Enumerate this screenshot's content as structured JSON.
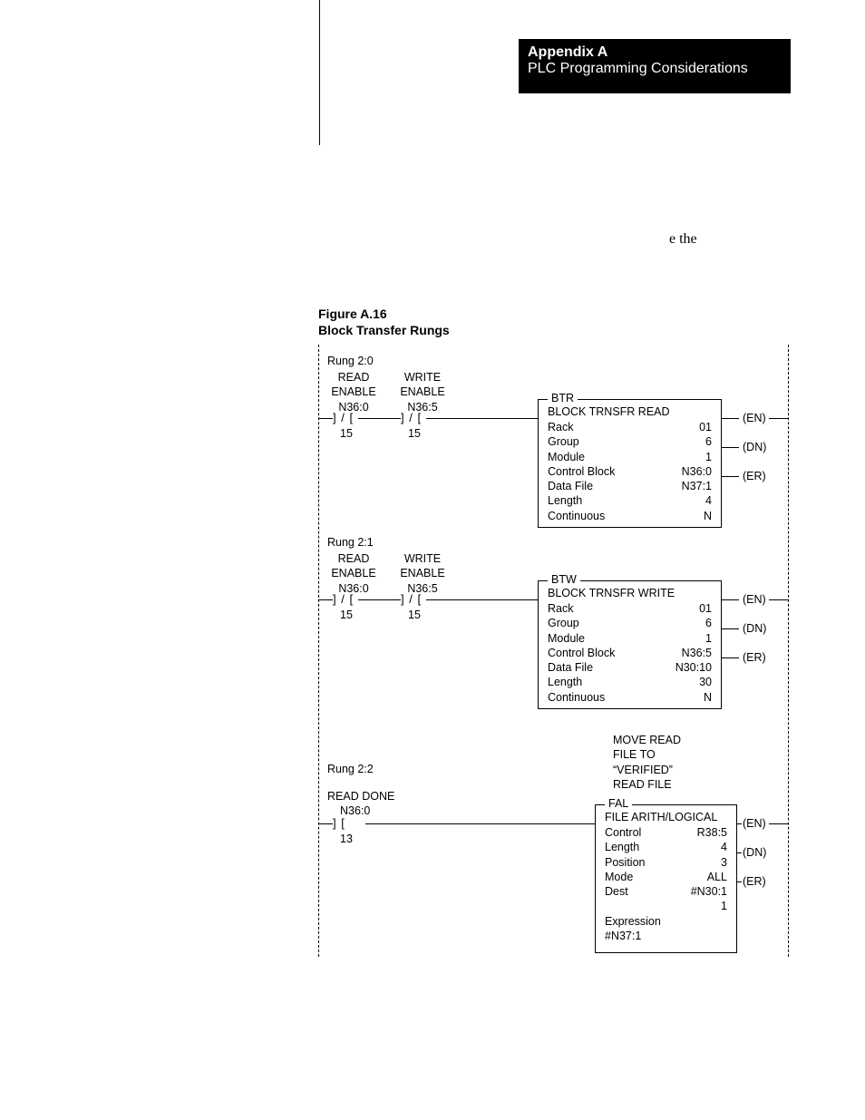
{
  "header": {
    "appendix": "Appendix A",
    "subtitle": "PLC Programming Considerations"
  },
  "stray_text": "e the",
  "figure_caption": {
    "line1": "Figure A.16",
    "line2": "Block Transfer Rungs"
  },
  "rungs": [
    {
      "label": "Rung 2:0",
      "contacts": [
        {
          "l1": "READ",
          "l2": "ENABLE",
          "addr": "N36:0",
          "sym": "] / [",
          "bit": "15"
        },
        {
          "l1": "WRITE",
          "l2": "ENABLE",
          "addr": "N36:5",
          "sym": "] / [",
          "bit": "15"
        }
      ],
      "block": {
        "mnemonic": "BTR",
        "title": "BLOCK TRNSFR READ",
        "rows": [
          [
            "Rack",
            "01"
          ],
          [
            "Group",
            "6"
          ],
          [
            "Module",
            "1"
          ],
          [
            "Control Block",
            "N36:0"
          ],
          [
            "Data File",
            "N37:1"
          ],
          [
            "Length",
            "4"
          ],
          [
            "Continuous",
            "N"
          ]
        ],
        "outs": [
          "(EN)",
          "(DN)",
          "(ER)"
        ]
      }
    },
    {
      "label": "Rung 2:1",
      "contacts": [
        {
          "l1": "READ",
          "l2": "ENABLE",
          "addr": "N36:0",
          "sym": "] / [",
          "bit": "15"
        },
        {
          "l1": "WRITE",
          "l2": "ENABLE",
          "addr": "N36:5",
          "sym": "] / [",
          "bit": "15"
        }
      ],
      "block": {
        "mnemonic": "BTW",
        "title": "BLOCK TRNSFR WRITE",
        "rows": [
          [
            "Rack",
            "01"
          ],
          [
            "Group",
            "6"
          ],
          [
            "Module",
            "1"
          ],
          [
            "Control Block",
            "N36:5"
          ],
          [
            "Data File",
            "N30:10"
          ],
          [
            "Length",
            "30"
          ],
          [
            "Continuous",
            "N"
          ]
        ],
        "outs": [
          "(EN)",
          "(DN)",
          "(ER)"
        ]
      }
    },
    {
      "label": "Rung 2:2",
      "comment": [
        "MOVE READ",
        "FILE TO",
        "“VERIFIED”",
        "READ FILE"
      ],
      "contacts": [
        {
          "l1": "READ DONE",
          "l2": "",
          "addr": "N36:0",
          "sym": "]   [",
          "bit": "13"
        }
      ],
      "block": {
        "mnemonic": "FAL",
        "title": "FILE ARITH/LOGICAL",
        "rows": [
          [
            "Control",
            "R38:5"
          ],
          [
            "Length",
            "4"
          ],
          [
            "Position",
            "3"
          ],
          [
            "Mode",
            "ALL"
          ],
          [
            "Dest",
            "#N30:1"
          ],
          [
            "",
            "1"
          ],
          [
            "Expression",
            ""
          ],
          [
            "#N37:1",
            ""
          ]
        ],
        "outs": [
          "(EN)",
          "(DN)",
          "(ER)"
        ]
      }
    }
  ]
}
